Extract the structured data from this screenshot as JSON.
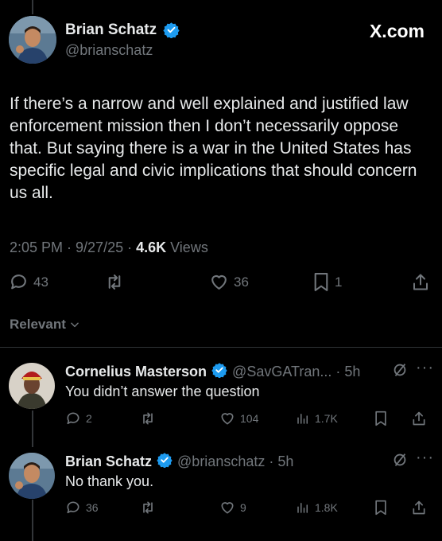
{
  "main_tweet": {
    "name": "Brian Schatz",
    "handle": "@brianschatz",
    "site": "X.com",
    "text": "If there’s a narrow and well explained and justified law enforcement mission then I don’t necessarily oppose that. But saying there is a war in the United States has specific legal and civic implications that should concern us all.",
    "time": "2:05 PM · 9/27/25 · ",
    "views_count": "4.6K",
    "views_label": " Views",
    "replies": "43",
    "likes": "36",
    "bookmarks": "1"
  },
  "sort": {
    "label": "Relevant"
  },
  "replies": [
    {
      "name": "Cornelius Masterson",
      "handle": "@SavGATran... · 5h",
      "text": "You didn’t answer the question",
      "reply_count": "2",
      "like_count": "104",
      "view_count": "1.7K"
    },
    {
      "name": "Brian Schatz",
      "handle": "@brianschatz · 5h",
      "text": "No thank you.",
      "reply_count": "36",
      "like_count": "9",
      "view_count": "1.8K"
    }
  ],
  "colors": {
    "background": "#000000",
    "text": "#e7e9ea",
    "muted": "#71767b",
    "verified": "#1d9bf0"
  }
}
